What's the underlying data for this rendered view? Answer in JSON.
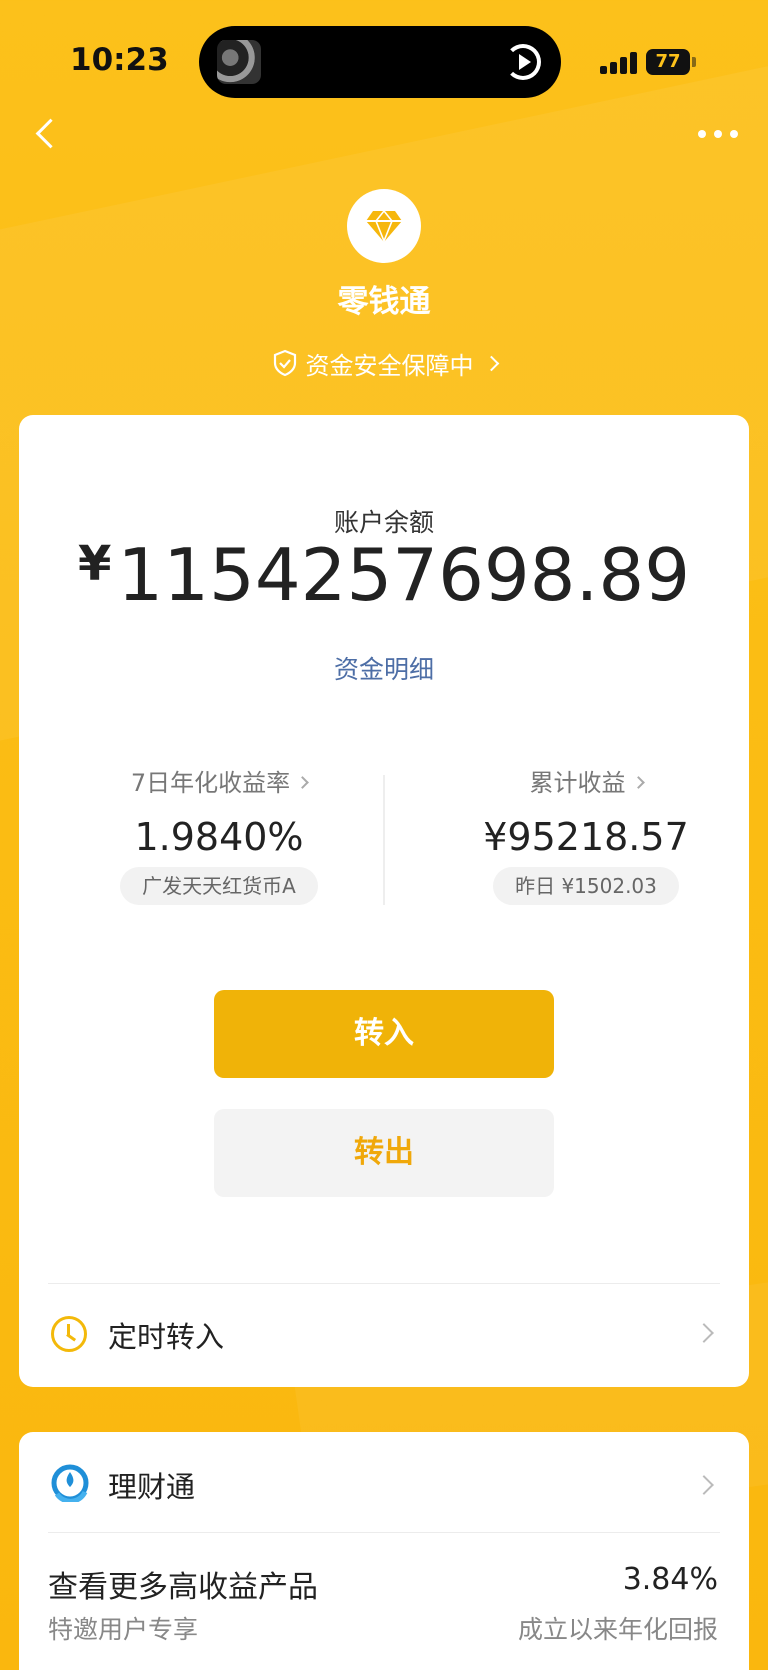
{
  "status_bar": {
    "time": "10:23",
    "battery": "77"
  },
  "header": {
    "brand_title": "零钱通",
    "security_text": "资金安全保障中"
  },
  "balance": {
    "label": "账户余额",
    "currency": "¥",
    "amount": "1154257698.89",
    "detail_link": "资金明细"
  },
  "stats": {
    "yield": {
      "label": "7日年化收益率",
      "value": "1.9840%",
      "fund": "广发天天红货币A"
    },
    "earnings": {
      "label": "累计收益",
      "value": "¥95218.57",
      "yesterday": "昨日 ¥1502.03"
    }
  },
  "actions": {
    "transfer_in": "转入",
    "transfer_out": "转出"
  },
  "scheduled": {
    "label": "定时转入"
  },
  "licaitong": {
    "label": "理财通",
    "promo_title": "查看更多高收益产品",
    "promo_sub": "特邀用户专享",
    "rate": "3.84%",
    "rate_label": "成立以来年化回报"
  },
  "colors": {
    "accent": "#fcc11b",
    "button": "#f0b308",
    "link": "#4d6ea6"
  }
}
